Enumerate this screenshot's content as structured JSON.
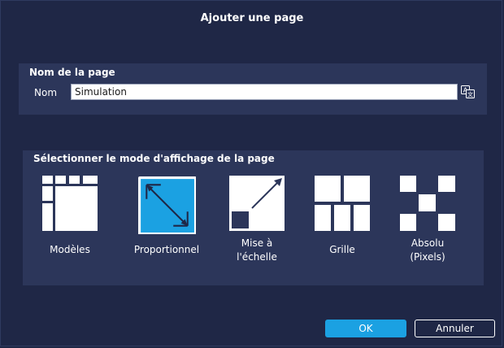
{
  "dialog": {
    "title": "Ajouter une page"
  },
  "name_section": {
    "title": "Nom de la page",
    "field_label": "Nom",
    "field_value": "Simulation",
    "translate_icon": "translate-icon"
  },
  "mode_section": {
    "title": "Sélectionner le mode d'affichage de la page",
    "modes": [
      {
        "label": "Modèles",
        "icon": "templates-icon",
        "selected": false
      },
      {
        "label": "Proportionnel",
        "icon": "proportional-icon",
        "selected": true
      },
      {
        "label_line1": "Mise à",
        "label_line2": "l'échelle",
        "icon": "scale-icon",
        "selected": false
      },
      {
        "label": "Grille",
        "icon": "grid-icon",
        "selected": false
      },
      {
        "label_line1": "Absolu",
        "label_line2": "(Pixels)",
        "icon": "absolute-icon",
        "selected": false
      }
    ]
  },
  "buttons": {
    "ok": "OK",
    "cancel": "Annuler"
  },
  "colors": {
    "background": "#1f2746",
    "section": "#2c365a",
    "accent": "#1ba1e2"
  }
}
